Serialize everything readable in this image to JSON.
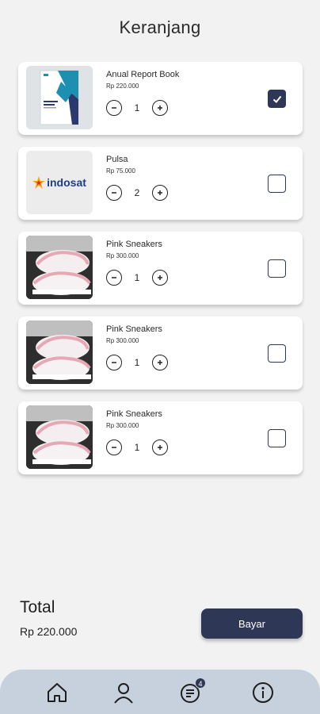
{
  "header": {
    "title": "Keranjang"
  },
  "cart": {
    "items": [
      {
        "name": "Anual Report Book",
        "price": "Rp 220.000",
        "qty": "1",
        "checked": true,
        "image": "report-book"
      },
      {
        "name": "Pulsa",
        "price": "Rp 75.000",
        "qty": "2",
        "checked": false,
        "image": "indosat-logo",
        "logo_text": "indosat"
      },
      {
        "name": "Pink Sneakers",
        "price": "Rp 300.000",
        "qty": "1",
        "checked": false,
        "image": "pink-sneakers"
      },
      {
        "name": "Pink Sneakers",
        "price": "Rp 300.000",
        "qty": "1",
        "checked": false,
        "image": "pink-sneakers"
      },
      {
        "name": "Pink Sneakers",
        "price": "Rp 300.000",
        "qty": "1",
        "checked": false,
        "image": "pink-sneakers"
      }
    ]
  },
  "summary": {
    "total_label": "Total",
    "total_value": "Rp 220.000",
    "pay_label": "Bayar"
  },
  "nav": {
    "items": [
      {
        "icon": "home-icon"
      },
      {
        "icon": "profile-icon"
      },
      {
        "icon": "orders-icon",
        "badge": "4"
      },
      {
        "icon": "info-icon"
      }
    ]
  },
  "colors": {
    "primary": "#2f3757",
    "background": "#f2f2f2",
    "nav_bg": "#c7d0dd",
    "indosat_blue": "#1f3c8f"
  }
}
